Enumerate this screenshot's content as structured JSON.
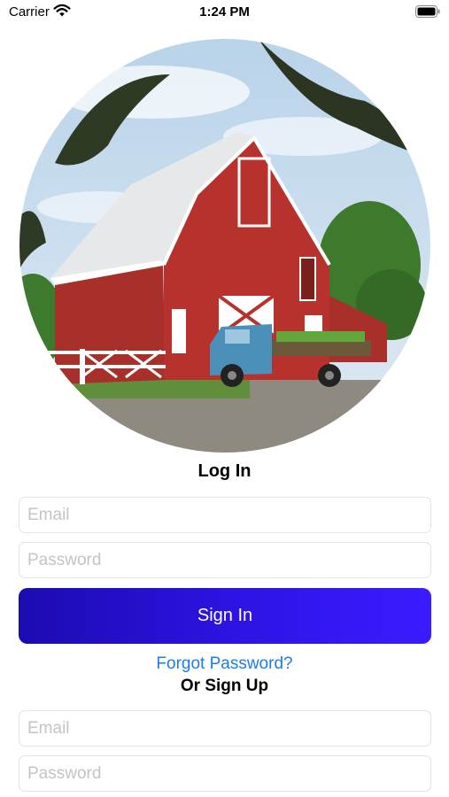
{
  "status_bar": {
    "carrier": "Carrier",
    "time": "1:24 PM"
  },
  "login": {
    "title": "Log In",
    "email_placeholder": "Email",
    "password_placeholder": "Password",
    "submit_label": "Sign In",
    "forgot_label": "Forgot Password?"
  },
  "signup": {
    "title": "Or Sign Up",
    "email_placeholder": "Email",
    "password_placeholder": "Password"
  },
  "colors": {
    "button_gradient_start": "#1c0bb0",
    "button_gradient_end": "#3b1bff",
    "link": "#1a7cf0"
  },
  "icons": {
    "wifi": "wifi-icon",
    "battery": "battery-icon"
  }
}
